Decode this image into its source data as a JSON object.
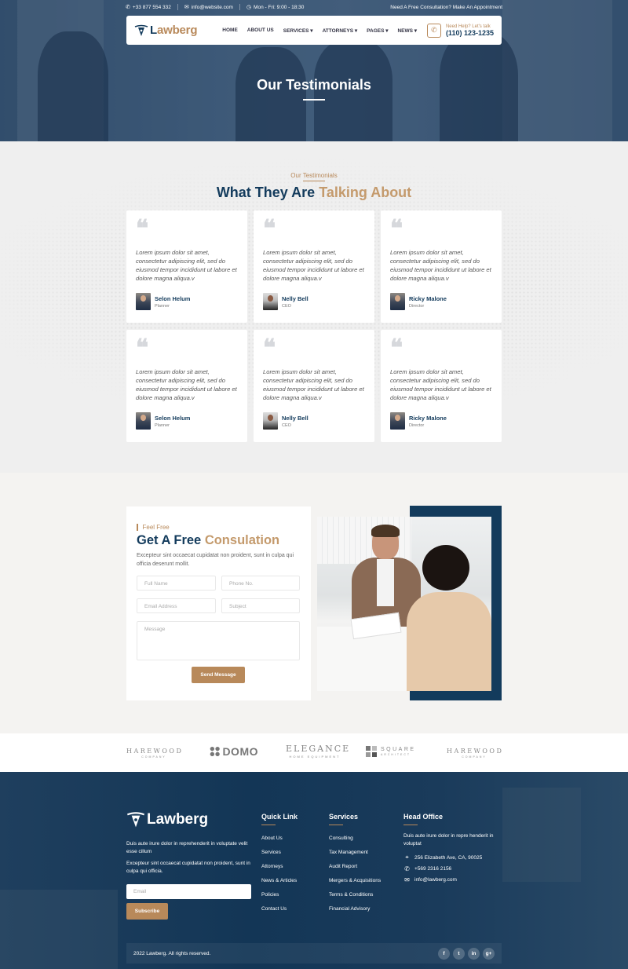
{
  "topbar": {
    "phone": "+33 877 554 332",
    "email": "info@website.com",
    "hours": "Mon - Fri: 9:00 - 18:30",
    "cta": "Need A Free Consultation? Make An Appointment"
  },
  "brand": {
    "logo_accent": "L",
    "logo_rest": "awberg"
  },
  "nav": {
    "items": [
      "HOME",
      "ABOUT US",
      "SERVICES ▾",
      "ATTORNEYS ▾",
      "PAGES ▾",
      "NEWS ▾"
    ],
    "help_label": "Need Help? Let's talk",
    "help_phone": "(110) 123-1235"
  },
  "hero": {
    "title": "Our Testimonials"
  },
  "testimonials": {
    "kicker": "Our Testimonials",
    "title_main": "What They Are",
    "title_accent": "Talking About",
    "cards": [
      {
        "text": "Lorem ipsum dolor sit amet, consectetur adipiscing elit, sed do eiusmod tempor incididunt ut labore et dolore magna aliqua.v",
        "name": "Selon Helum",
        "role": "Planner"
      },
      {
        "text": "Lorem ipsum dolor sit amet, consectetur adipiscing elit, sed do eiusmod tempor incididunt ut labore et dolore magna aliqua.v",
        "name": "Nelly Bell",
        "role": "CEO"
      },
      {
        "text": "Lorem ipsum dolor sit amet, consectetur adipiscing elit, sed do eiusmod tempor incididunt ut labore et dolore magna aliqua.v",
        "name": "Ricky Malone",
        "role": "Director"
      },
      {
        "text": "Lorem ipsum dolor sit amet, consectetur adipiscing elit, sed do eiusmod tempor incididunt ut labore et dolore magna aliqua.v",
        "name": "Selon Helum",
        "role": "Planner"
      },
      {
        "text": "Lorem ipsum dolor sit amet, consectetur adipiscing elit, sed do eiusmod tempor incididunt ut labore et dolore magna aliqua.v",
        "name": "Nelly Bell",
        "role": "CEO"
      },
      {
        "text": "Lorem ipsum dolor sit amet, consectetur adipiscing elit, sed do eiusmod tempor incididunt ut labore et dolore magna aliqua.v",
        "name": "Ricky Malone",
        "role": "Director"
      }
    ]
  },
  "consult": {
    "kicker": "Feel Free",
    "title_main": "Get A Free",
    "title_accent": "Consulation",
    "desc": "Excepteur sint occaecat cupidatat non proident, sunt in culpa qui officia deserunt mollit.",
    "full_name": "Full Name",
    "phone": "Phone No.",
    "email": "Email Address",
    "subject": "Subject",
    "message": "Message",
    "send": "Send Message"
  },
  "brands": [
    {
      "name": "HAREWOOD",
      "sub": "COMPANY"
    },
    {
      "name": "DOMO",
      "sub": ""
    },
    {
      "name": "ELEGANCE",
      "sub": "HOME EQUIPMENT"
    },
    {
      "name": "SQUARE",
      "sub": "ARCHITECT"
    },
    {
      "name": "HAREWOOD",
      "sub": "COMPANY"
    }
  ],
  "footer": {
    "logo": "Lawberg",
    "about1": "Duis aute irure dolor in reprehenderit in voluptate velit esse cillum",
    "about2": "Excepteur sint occaecat cupidatat non proident, sunt in culpa qui officia.",
    "email_placeholder": "Email",
    "subscribe": "Subscribe",
    "quick_title": "Quick Link",
    "quick_links": [
      "About Us",
      "Services",
      "Attorneys",
      "News & Articles",
      "Policies",
      "Contact Us"
    ],
    "services_title": "Services",
    "services": [
      "Consulting",
      "Tax Management",
      "Audit Report",
      "Mergers & Acquisitions",
      "Terms & Conditions",
      "Financial Advisory"
    ],
    "office_title": "Head Office",
    "office_text": "Duis aute irure dolor in repre henderit in voluptat",
    "address": "256 Elizabeth Ave, CA, 90025",
    "office_phone": "+569 2316 2156",
    "office_email": "info@lawberg.com",
    "copyright": "2022 Lawberg. All rights reserved.",
    "socials": [
      "f",
      "t",
      "in",
      "g+"
    ]
  },
  "colors": {
    "primary": "#133b5c",
    "accent": "#b8895a"
  }
}
